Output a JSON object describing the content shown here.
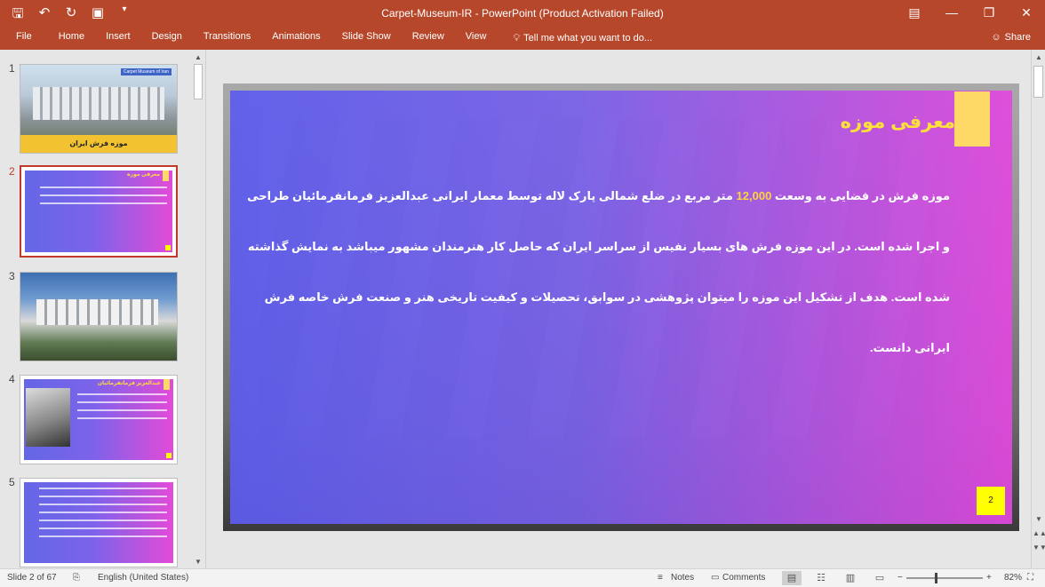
{
  "titlebar": {
    "title": "Carpet-Museum-IR - PowerPoint (Product Activation Failed)",
    "qat": [
      "save-icon",
      "undo-icon",
      "redo-icon",
      "present-icon",
      "customize-icon"
    ],
    "controls": [
      "ribbon-display-icon",
      "minimize-icon",
      "restore-icon",
      "close-icon"
    ]
  },
  "ribbon": {
    "tabs": [
      "File",
      "Home",
      "Insert",
      "Design",
      "Transitions",
      "Animations",
      "Slide Show",
      "Review",
      "View"
    ],
    "tellme": "Tell me what you want to do...",
    "share": "Share"
  },
  "thumbnails": [
    {
      "num": "1",
      "caption": "موزه فرش ایران",
      "tag": "Carpet Museum of Iran"
    },
    {
      "num": "2",
      "title": "معرفی موزه"
    },
    {
      "num": "3"
    },
    {
      "num": "4",
      "title": "عبدالعزیز فرمانفرمائیان"
    },
    {
      "num": "5"
    }
  ],
  "slide": {
    "title": "معرفی موزه",
    "body_pre": "موزه فرش در فضایی به وسعت ",
    "body_highlight": "12,000",
    "body_post": " متر مربع در ضلع شمالی پارک لاله توسط معمار ایرانی عبدالعزیز فرمانفرمائیان طراحی و اجرا شده است. در این موزه فرش های بسیار نفیس از سراسر ایران که حاصل کار هنرمندان مشهور میباشد به نمایش گذاشته شده است. هدف از تشکیل این موزه را میتوان پژوهشی در سوابق، تحصیلات و کیفیت تاریخی هنر و صنعت فرش خاصه فرش ایرانی دانست.",
    "page_number": "2"
  },
  "status": {
    "slide_info": "Slide 2 of 67",
    "language": "English (United States)",
    "notes": "Notes",
    "comments": "Comments",
    "zoom": "82%"
  },
  "colors": {
    "accent": "#b7472a",
    "slide_title": "#ffe13a",
    "highlight": "#ffd53d",
    "page_box": "#ffff00"
  }
}
